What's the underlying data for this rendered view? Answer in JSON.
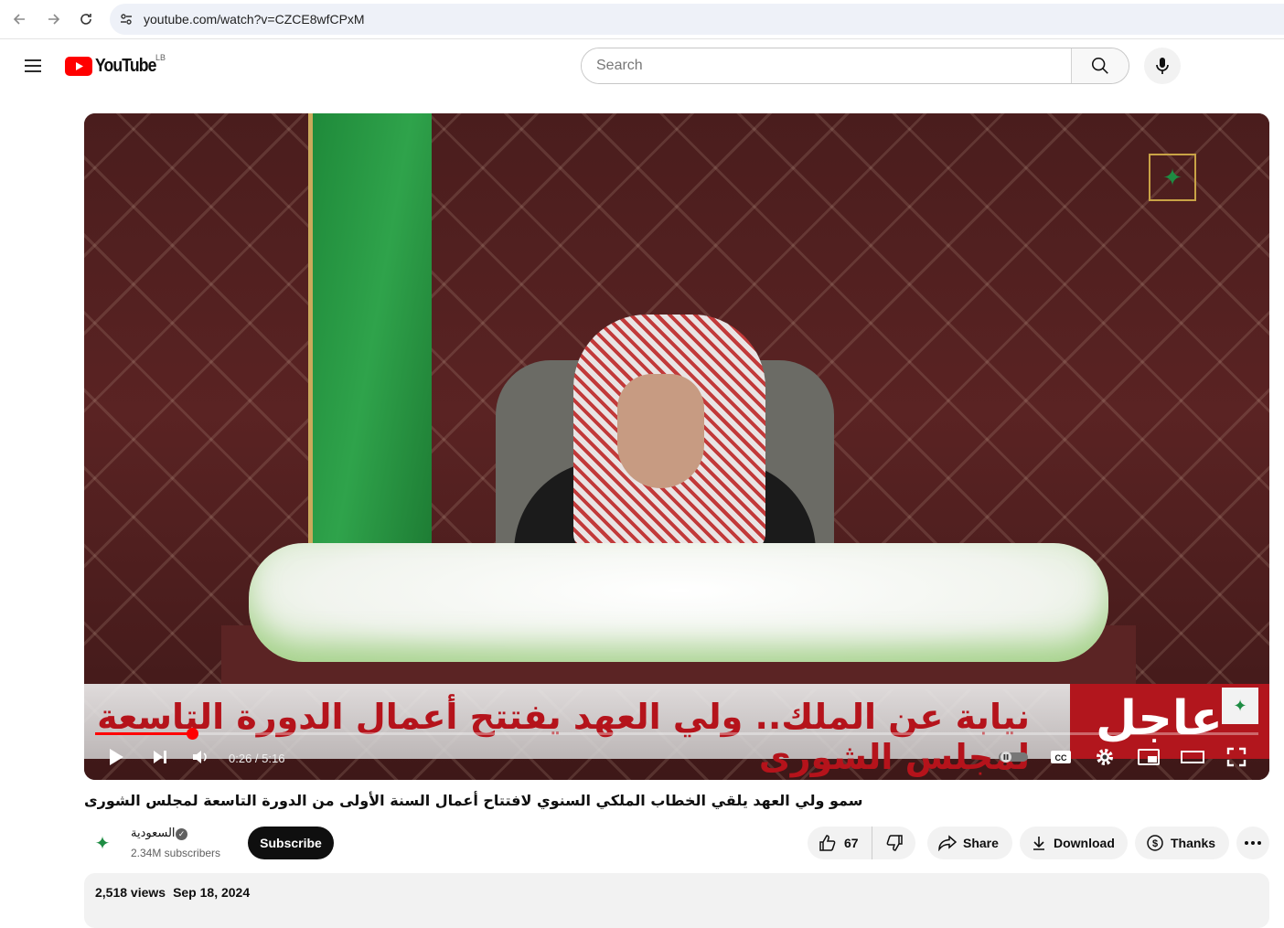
{
  "browser": {
    "url": "youtube.com/watch?v=CZCE8wfCPxM"
  },
  "header": {
    "logo_text": "YouTube",
    "country_code": "LB",
    "search_placeholder": "Search"
  },
  "player": {
    "lower_third_text": "نيابة عن الملك.. ولي العهد يفتتح أعمال الدورة التاسعة لمجلس الشورى",
    "breaking_label": "عاجل",
    "time_display": "0:26 / 5:16",
    "progress_fraction": 0.083
  },
  "video": {
    "title": "سمو ولي العهد يلقي الخطاب الملكي السنوي لافتتاح أعمال السنة الأولى من الدورة التاسعة لمجلس الشورى"
  },
  "channel": {
    "name": "السعودية",
    "subscribers": "2.34M subscribers",
    "subscribe_label": "Subscribe"
  },
  "actions": {
    "likes": "67",
    "share_label": "Share",
    "download_label": "Download",
    "thanks_label": "Thanks"
  },
  "description": {
    "views": "2,518 views",
    "date": "Sep 18, 2024"
  },
  "colors": {
    "brand_red": "#FF0000",
    "breaking_red": "#B2161D"
  }
}
